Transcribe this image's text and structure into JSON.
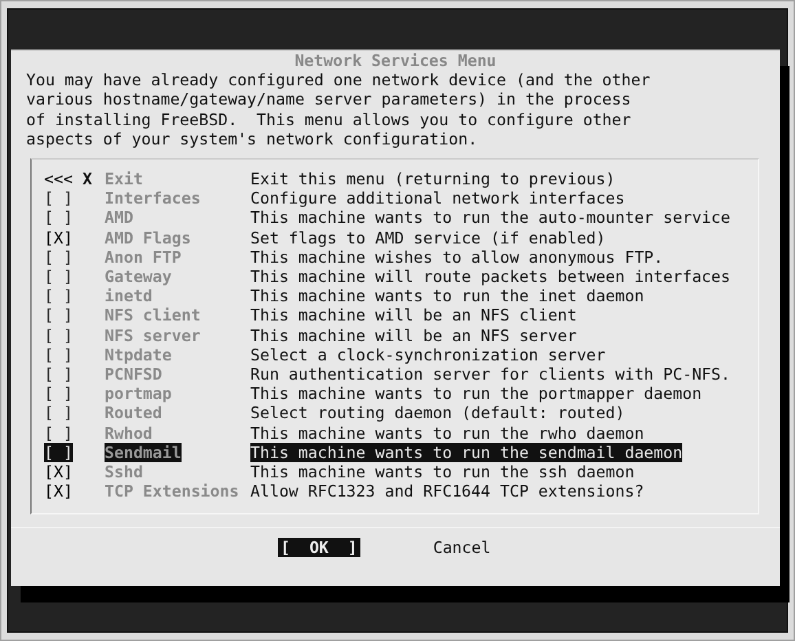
{
  "dialog": {
    "title": "Network Services Menu",
    "intro": "You may have already configured one network device (and the other\nvarious hostname/gateway/name server parameters) in the process\nof installing FreeBSD.  This menu allows you to configure other\naspects of your system's network configuration."
  },
  "menu": {
    "items": [
      {
        "kind": "exit",
        "prefix": "<<<",
        "hotkey": "X",
        "name": "Exit",
        "description": "Exit this menu (returning to previous)",
        "selected": false
      },
      {
        "kind": "option",
        "box": "[ ]",
        "checked": false,
        "name": "Interfaces",
        "description": "Configure additional network interfaces",
        "selected": false
      },
      {
        "kind": "option",
        "box": "[ ]",
        "checked": false,
        "name": "AMD",
        "description": "This machine wants to run the auto-mounter service",
        "selected": false
      },
      {
        "kind": "option",
        "box": "[X]",
        "checked": true,
        "name": "AMD Flags",
        "description": "Set flags to AMD service (if enabled)",
        "selected": false
      },
      {
        "kind": "option",
        "box": "[ ]",
        "checked": false,
        "name": "Anon FTP",
        "description": "This machine wishes to allow anonymous FTP.",
        "selected": false
      },
      {
        "kind": "option",
        "box": "[ ]",
        "checked": false,
        "name": "Gateway",
        "description": "This machine will route packets between interfaces",
        "selected": false
      },
      {
        "kind": "option",
        "box": "[ ]",
        "checked": false,
        "name": "inetd",
        "description": "This machine wants to run the inet daemon",
        "selected": false
      },
      {
        "kind": "option",
        "box": "[ ]",
        "checked": false,
        "name": "NFS client",
        "description": "This machine will be an NFS client",
        "selected": false
      },
      {
        "kind": "option",
        "box": "[ ]",
        "checked": false,
        "name": "NFS server",
        "description": "This machine will be an NFS server",
        "selected": false
      },
      {
        "kind": "option",
        "box": "[ ]",
        "checked": false,
        "name": "Ntpdate",
        "description": "Select a clock-synchronization server",
        "selected": false
      },
      {
        "kind": "option",
        "box": "[ ]",
        "checked": false,
        "name": "PCNFSD",
        "description": "Run authentication server for clients with PC-NFS.",
        "selected": false
      },
      {
        "kind": "option",
        "box": "[ ]",
        "checked": false,
        "name": "portmap",
        "description": "This machine wants to run the portmapper daemon",
        "selected": false
      },
      {
        "kind": "option",
        "box": "[ ]",
        "checked": false,
        "name": "Routed",
        "description": "Select routing daemon (default: routed)",
        "selected": false
      },
      {
        "kind": "option",
        "box": "[ ]",
        "checked": false,
        "name": "Rwhod",
        "description": "This machine wants to run the rwho daemon",
        "selected": false
      },
      {
        "kind": "option",
        "box": "[ ]",
        "checked": false,
        "name": "Sendmail",
        "description": "This machine wants to run the sendmail daemon",
        "selected": true
      },
      {
        "kind": "option",
        "box": "[X]",
        "checked": true,
        "name": "Sshd",
        "description": "This machine wants to run the ssh daemon",
        "selected": false
      },
      {
        "kind": "option",
        "box": "[X]",
        "checked": true,
        "name": "TCP Extensions",
        "description": "Allow RFC1323 and RFC1644 TCP extensions?",
        "selected": false
      }
    ]
  },
  "buttons": [
    {
      "label": "[  OK  ]",
      "selected": true
    },
    {
      "label": "Cancel",
      "selected": false
    }
  ]
}
